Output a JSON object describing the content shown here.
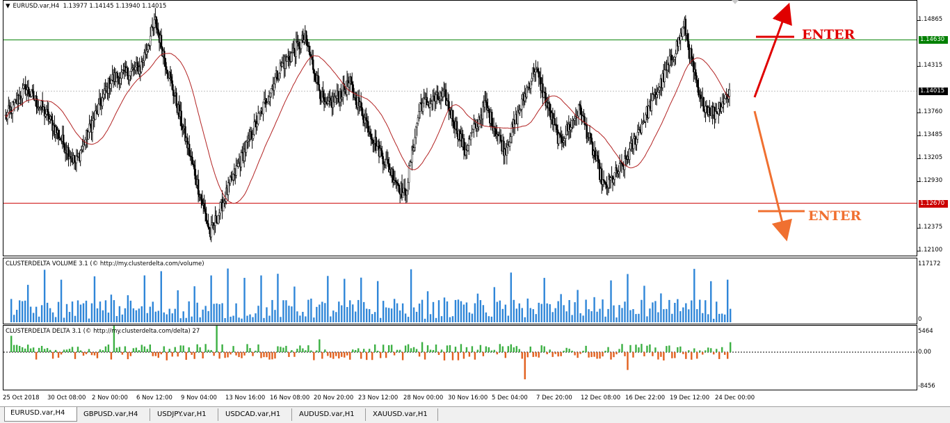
{
  "chart_header": {
    "symbol": "EURUSD.var,H4",
    "ohlc": "1.13977 1.14145 1.13940 1.14015",
    "menu_arrow": "▼"
  },
  "price_axis": [
    "1.14865",
    "1.14315",
    "1.13760",
    "1.13485",
    "1.13205",
    "1.12930",
    "1.12375",
    "1.12100"
  ],
  "price_axis_values": [
    1.14865,
    1.14315,
    1.1376,
    1.13485,
    1.13205,
    1.1293,
    1.12375,
    1.121
  ],
  "price_range": [
    1.1205,
    1.151
  ],
  "levels": {
    "upper": {
      "value": 1.1463,
      "label": "1.14630",
      "color": "#008000"
    },
    "lower": {
      "value": 1.1267,
      "label": "1.12670",
      "color": "#cc0000"
    },
    "current": {
      "value": 1.14015,
      "label": "1.14015"
    }
  },
  "annotations": {
    "enter_up": "ENTER",
    "enter_down": "ENTER",
    "up_color": "#e00000",
    "down_color": "#f07030"
  },
  "volume_pane": {
    "title": "CLUSTERDELTA VOLUME 3.1 (© http://my.clusterdelta.com/volume)",
    "axis_max": "117172",
    "axis_min": "0",
    "bar_color": "#2f86d8"
  },
  "delta_pane": {
    "title": "CLUSTERDELTA DELTA 3.1 (© http://my.clusterdelta.com/delta) 27",
    "axis_max": "5464",
    "axis_zero": "0.00",
    "axis_min": "-8456",
    "pos_color": "#3cb043",
    "neg_color": "#e2601e"
  },
  "time_axis": [
    "25 Oct 2018",
    "30 Oct 08:00",
    "2 Nov 00:00",
    "6 Nov 12:00",
    "9 Nov 04:00",
    "13 Nov 16:00",
    "16 Nov 08:00",
    "20 Nov 20:00",
    "23 Nov 12:00",
    "28 Nov 00:00",
    "30 Nov 16:00",
    "5 Dec 04:00",
    "7 Dec 20:00",
    "12 Dec 08:00",
    "16 Dec 22:00",
    "19 Dec 12:00",
    "24 Dec 00:00"
  ],
  "tabs": [
    {
      "label": "EURUSD.var,H4",
      "active": true
    },
    {
      "label": "GBPUSD.var,H4",
      "active": false
    },
    {
      "label": "USDJPY.var,H1",
      "active": false
    },
    {
      "label": "USDCAD.var,H1",
      "active": false
    },
    {
      "label": "AUDUSD.var,H1",
      "active": false
    },
    {
      "label": "XAUUSD.var,H1",
      "active": false
    }
  ],
  "chart_data": {
    "type": "candlestick",
    "title": "EURUSD.var,H4",
    "ylim": [
      1.1205,
      1.151
    ],
    "series_shape": [
      {
        "bar": 0,
        "close": 1.137
      },
      {
        "bar": 20,
        "close": 1.1405
      },
      {
        "bar": 40,
        "close": 1.1375
      },
      {
        "bar": 70,
        "close": 1.1315
      },
      {
        "bar": 105,
        "close": 1.1415
      },
      {
        "bar": 135,
        "close": 1.143
      },
      {
        "bar": 150,
        "close": 1.1485
      },
      {
        "bar": 165,
        "close": 1.1415
      },
      {
        "bar": 190,
        "close": 1.13
      },
      {
        "bar": 205,
        "close": 1.123
      },
      {
        "bar": 225,
        "close": 1.129
      },
      {
        "bar": 250,
        "close": 1.136
      },
      {
        "bar": 275,
        "close": 1.143
      },
      {
        "bar": 300,
        "close": 1.1465
      },
      {
        "bar": 320,
        "close": 1.138
      },
      {
        "bar": 345,
        "close": 1.141
      },
      {
        "bar": 370,
        "close": 1.134
      },
      {
        "bar": 400,
        "close": 1.1275
      },
      {
        "bar": 415,
        "close": 1.1385
      },
      {
        "bar": 440,
        "close": 1.1395
      },
      {
        "bar": 460,
        "close": 1.133
      },
      {
        "bar": 480,
        "close": 1.1385
      },
      {
        "bar": 500,
        "close": 1.133
      },
      {
        "bar": 530,
        "close": 1.143
      },
      {
        "bar": 555,
        "close": 1.134
      },
      {
        "bar": 575,
        "close": 1.138
      },
      {
        "bar": 600,
        "close": 1.1285
      },
      {
        "bar": 620,
        "close": 1.1315
      },
      {
        "bar": 640,
        "close": 1.137
      },
      {
        "bar": 660,
        "close": 1.142
      },
      {
        "bar": 680,
        "close": 1.148
      },
      {
        "bar": 695,
        "close": 1.139
      },
      {
        "bar": 710,
        "close": 1.1375
      },
      {
        "bar": 725,
        "close": 1.14015
      }
    ]
  }
}
